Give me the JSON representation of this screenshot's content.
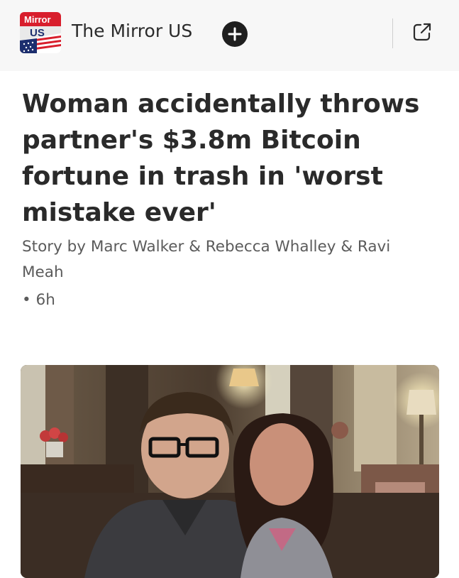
{
  "header": {
    "logo_text_top": "Mirror",
    "logo_text_bottom": "US",
    "source_name": "The Mirror US",
    "follow_icon": "plus-icon",
    "open_icon": "open-external-icon"
  },
  "article": {
    "headline": "Woman accidentally throws partner's $3.8m Bitcoin fortune in trash in 'worst mistake ever'",
    "byline": "Story by Marc Walker & Rebecca Whalley & Ravi Meah",
    "time": "• 6h"
  },
  "colors": {
    "logo_red": "#d81e2c",
    "logo_blue": "#1c2e6e",
    "follow_button": "#1f1f1f",
    "headline_text": "#2a2a2a",
    "meta_text": "#5b5b5b"
  }
}
